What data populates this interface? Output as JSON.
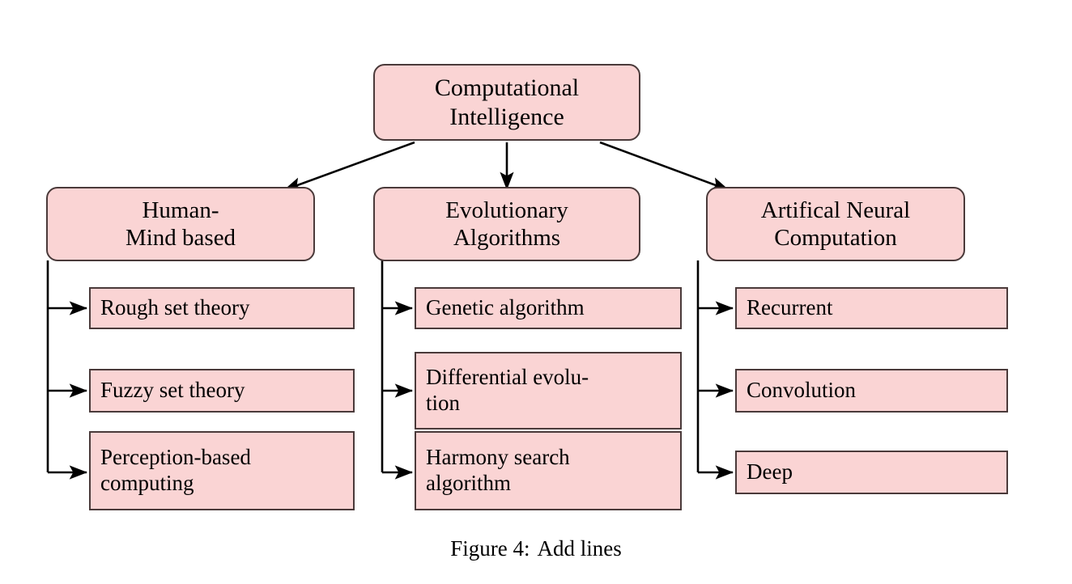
{
  "figure": {
    "caption_label": "Figure 4:",
    "caption_text": "Add lines",
    "colors": {
      "node_fill": "#fad4d4",
      "node_border": "#4a3a3a",
      "connector": "#000000",
      "background": "#ffffff",
      "text": "#000000"
    }
  },
  "diagram": {
    "type": "tree",
    "root": {
      "line1": "Computational",
      "line2": "Intelligence"
    },
    "categories": [
      {
        "line1": "Human-",
        "line2": "Mind based",
        "leaves": [
          {
            "line1": "Rough set theory",
            "line2": ""
          },
          {
            "line1": "Fuzzy set theory",
            "line2": ""
          },
          {
            "line1": "Perception-based",
            "line2": "computing"
          }
        ]
      },
      {
        "line1": "Evolutionary",
        "line2": "Algorithms",
        "leaves": [
          {
            "line1": "Genetic algorithm",
            "line2": ""
          },
          {
            "line1": "Differential evolu-",
            "line2": "tion"
          },
          {
            "line1": "Harmony search",
            "line2": "algorithm"
          }
        ]
      },
      {
        "line1": "Artifical Neural",
        "line2": "Computation",
        "leaves": [
          {
            "line1": "Recurrent",
            "line2": ""
          },
          {
            "line1": "Convolution",
            "line2": ""
          },
          {
            "line1": "Deep",
            "line2": ""
          }
        ]
      }
    ]
  }
}
